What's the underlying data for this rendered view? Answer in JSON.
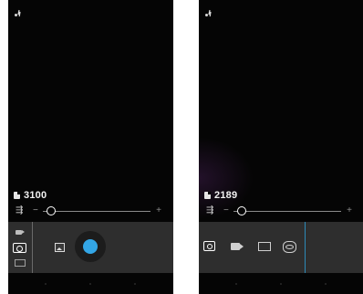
{
  "left_screen": {
    "remaining_shots": "3100",
    "exposure": {
      "minus": "−",
      "plus": "+",
      "ev_glyph": "⇶",
      "level_fraction": 0.08
    },
    "modes": [
      "video-icon",
      "camera-icon",
      "panorama-icon"
    ],
    "selected_mode": "camera-icon",
    "shutter_color": "#33a6e6"
  },
  "right_screen": {
    "remaining_shots": "2189",
    "exposure": {
      "minus": "−",
      "plus": "+",
      "ev_glyph": "⇶",
      "level_fraction": 0.08
    },
    "modes": [
      "camera-icon",
      "video-icon",
      "panorama-icon",
      "photosphere-icon"
    ],
    "selected_mode": "camera-icon",
    "divider_color": "#2d8ab8"
  }
}
